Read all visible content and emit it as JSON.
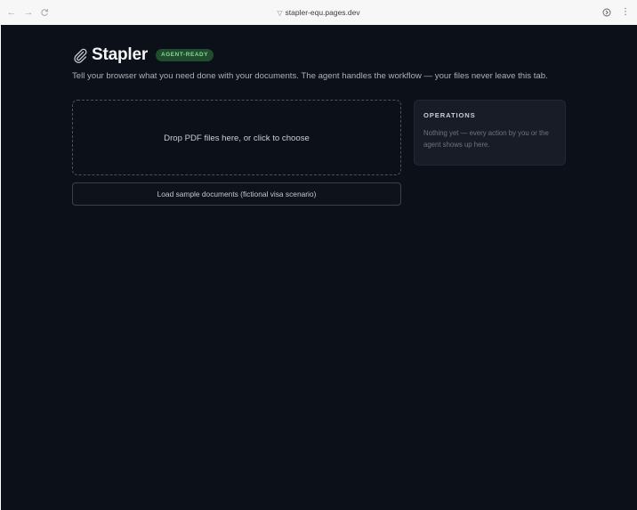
{
  "browser": {
    "url": "stapler-equ.pages.dev",
    "back_icon": "arrow-left-icon",
    "forward_icon": "arrow-right-icon",
    "reload_icon": "reload-icon"
  },
  "app": {
    "title": "Stapler",
    "badge": "AGENT-READY",
    "tagline": "Tell your browser what you need done with your documents. The agent handles the workflow — your files never leave this tab."
  },
  "dropzone": {
    "label": "Drop PDF files here, or click to choose"
  },
  "sample": {
    "label": "Load sample documents (fictional visa scenario)"
  },
  "operations": {
    "title": "OPERATIONS",
    "empty_text": "Nothing yet — every action by you or the agent shows up here."
  },
  "colors": {
    "background": "#0c1018",
    "badge_bg": "#1f4d2e",
    "badge_text": "#86d69a",
    "panel_bg": "#171c26"
  }
}
